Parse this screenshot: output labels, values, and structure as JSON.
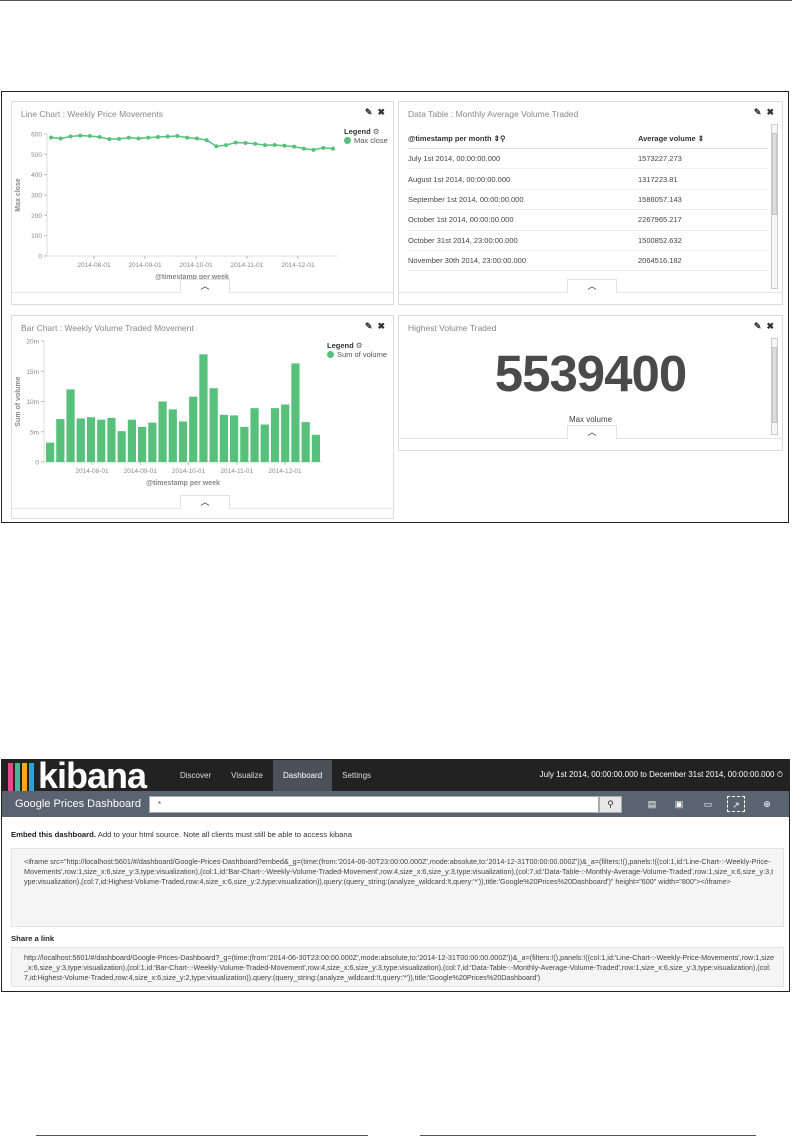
{
  "dashboard": {
    "panels": {
      "line": {
        "title": "Line Chart : Weekly Price Movements",
        "legend_title": "Legend",
        "series_name": "Max close",
        "ylabel": "Max close",
        "xlabel": "@timestamp per week"
      },
      "table": {
        "title": "Data Table : Monthly Average Volume Traded",
        "col1": "@timestamp per month",
        "col2": "Average volume",
        "rows": [
          [
            "July 1st 2014, 00:00:00.000",
            "1573227.273"
          ],
          [
            "August 1st 2014, 00:00:00.000",
            "1317223.81"
          ],
          [
            "September 1st 2014, 00:00:00.000",
            "1586057.143"
          ],
          [
            "October 1st 2014, 00:00:00.000",
            "2267965.217"
          ],
          [
            "October 31st 2014, 23:00:00.000",
            "1500852.632"
          ],
          [
            "November 30th 2014, 23:00:00.000",
            "2064516.182"
          ]
        ]
      },
      "bar": {
        "title": "Bar Chart : Weekly Volume Traded Movement",
        "legend_title": "Legend",
        "series_name": "Sum of volume",
        "ylabel": "Sum of volume",
        "xlabel": "@timestamp per week"
      },
      "metric": {
        "title": "Highest Volume Traded",
        "value": "5539400",
        "label": "Max volume"
      }
    }
  },
  "chart_data": [
    {
      "type": "line",
      "ylabel": "Max close",
      "xlabel": "@timestamp per week",
      "ylim": [
        0,
        600
      ],
      "yticks": [
        "0",
        "100",
        "200",
        "300",
        "400",
        "500",
        "600"
      ],
      "xticks": [
        "2014-08-01",
        "2014-09-01",
        "2014-10-01",
        "2014-11-01",
        "2014-12-01"
      ],
      "series": [
        {
          "name": "Max close",
          "values": [
            583,
            578,
            588,
            592,
            590,
            585,
            575,
            576,
            582,
            578,
            582,
            585,
            588,
            590,
            582,
            578,
            570,
            540,
            545,
            558,
            556,
            552,
            545,
            546,
            542,
            538,
            528,
            522,
            532,
            528
          ]
        }
      ],
      "legend": "top-right",
      "color": "#57c17b"
    },
    {
      "type": "bar",
      "ylabel": "Sum of volume",
      "xlabel": "@timestamp per week",
      "ylim": [
        0,
        20000000
      ],
      "yticks": [
        "0",
        "5m",
        "10m",
        "15m",
        "20m"
      ],
      "xticks": [
        "2014-08-01",
        "2014-09-01",
        "2014-10-01",
        "2014-11-01",
        "2014-12-01"
      ],
      "series": [
        {
          "name": "Sum of volume",
          "values": [
            3200000,
            7100000,
            12000000,
            7200000,
            7400000,
            7000000,
            7300000,
            5100000,
            7000000,
            5800000,
            6500000,
            10000000,
            8700000,
            6700000,
            10800000,
            17800000,
            12200000,
            7800000,
            7700000,
            5800000,
            8900000,
            6200000,
            8900000,
            9500000,
            16300000,
            6600000,
            4500000
          ]
        }
      ],
      "legend": "top-right",
      "color": "#57c17b"
    }
  ],
  "kibana": {
    "logo_text": "kibana",
    "logo_colors": [
      "#e8488b",
      "#3cbe8c",
      "#f5a81c",
      "#2ca3d8"
    ],
    "nav": [
      "Discover",
      "Visualize",
      "Dashboard",
      "Settings"
    ],
    "active_nav": "Dashboard",
    "time_range": "July 1st 2014, 00:00:00.000 to December 31st 2014, 00:00:00.000",
    "dashboard_title": "Google Prices Dashboard",
    "search_value": "*",
    "embed_heading": "Embed this dashboard.",
    "embed_note": "Add to your html source. Note all clients must still be able to access kibana",
    "embed_code": "<iframe src=\"http://localhost:5601/#/dashboard/Google-Prices-Dashboard?embed&_g=(time:(from:'2014-06-30T23:00:00.000Z',mode:absolute,to:'2014-12-31T00:00:00.000Z'))&_a=(filters:!(),panels:!((col:1,id:'Line-Chart-:-Weekly-Price-Movements',row:1,size_x:6,size_y:3,type:visualization),(col:1,id:'Bar-Chart-:-Weekly-Volume-Traded-Movement',row:4,size_x:6,size_y:3,type:visualization),(col:7,id:'Data-Table-:-Monthly-Average-Volume-Traded',row:1,size_x:6,size_y:3,type:visualization),(col:7,id:Highest-Volume-Traded,row:4,size_x:6,size_y:2,type:visualization)),query:(query_string:(analyze_wildcard:!t,query:'*')),title:'Google%20Prices%20Dashboard')\" height=\"600\" width=\"800\"></iframe>",
    "share_heading": "Share a link",
    "share_link": "http://localhost:5601/#/dashboard/Google-Prices-Dashboard?_g=(time:(from:'2014-06-30T23:00:00.000Z',mode:absolute,to:'2014-12-31T00:00:00.000Z'))&_a=(filters:!(),panels:!((col:1,id:'Line-Chart-:-Weekly-Price-Movements',row:1,size_x:6,size_y:3,type:visualization),(col:1,id:'Bar-Chart-:-Weekly-Volume-Traded-Movement',row:4,size_x:6,size_y:3,type:visualization),(col:7,id:'Data-Table-:-Monthly-Average-Volume-Traded',row:1,size_x:6,size_y:3,type:visualization),(col:7,id:Highest-Volume-Traded,row:4,size_x:6,size_y:2,type:visualization)),query:(query_string:(analyze_wildcard:!t,query:'*')),title:'Google%20Prices%20Dashboard')"
  }
}
